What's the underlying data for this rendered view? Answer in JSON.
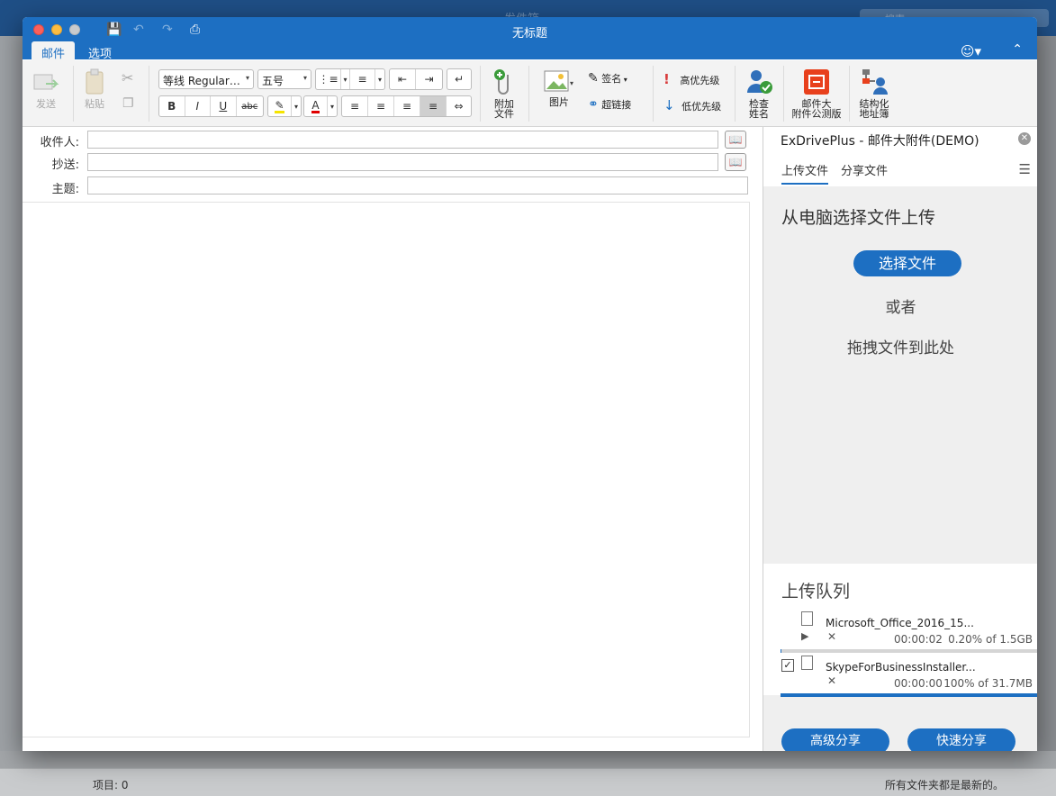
{
  "window": {
    "title": "无标题"
  },
  "ribbon_tabs": [
    "邮件",
    "选项"
  ],
  "ribbon": {
    "send": "发送",
    "paste": "粘贴",
    "font_name": "等线 Regular…",
    "font_size": "五号",
    "attach": [
      "附加",
      "文件"
    ],
    "picture": "图片",
    "signature": "签名",
    "hyperlink": "超链接",
    "high_priority": "高优先级",
    "low_priority": "低优先级",
    "check_names": [
      "检查",
      "姓名"
    ],
    "big_attach": [
      "邮件大",
      "附件公测版"
    ],
    "struct_book": [
      "结构化",
      "地址簿"
    ]
  },
  "fields": {
    "to_label": "收件人:",
    "cc_label": "抄送:",
    "subject_label": "主题:"
  },
  "panel": {
    "title": "ExDrivePlus - 邮件大附件(DEMO)",
    "tabs": [
      "上传文件",
      "分享文件"
    ],
    "upload_heading": "从电脑选择文件上传",
    "choose_button": "选择文件",
    "or_text": "或者",
    "drag_text": "拖拽文件到此处",
    "queue_title": "上传队列",
    "queue": [
      {
        "name": "Microsoft_Office_2016_15...",
        "time": "00:00:02",
        "progress": "0.20% of 1.5GB",
        "percent": 0.2,
        "checked": false
      },
      {
        "name": "SkypeForBusinessInstaller...",
        "time": "00:00:00",
        "progress": "100% of 31.7MB",
        "percent": 100,
        "checked": true
      }
    ],
    "advanced_share": "高级分享",
    "quick_share": "快速分享"
  },
  "status": {
    "items": "项目: 0",
    "sync": "所有文件夹都是最新的。"
  },
  "background": {
    "title": "发件箱",
    "search_placeholder": "搜索"
  },
  "colors": {
    "accent": "#1d6fc2",
    "high_priority": "#d83b3b",
    "big_attach_icon": "#e8401c"
  }
}
